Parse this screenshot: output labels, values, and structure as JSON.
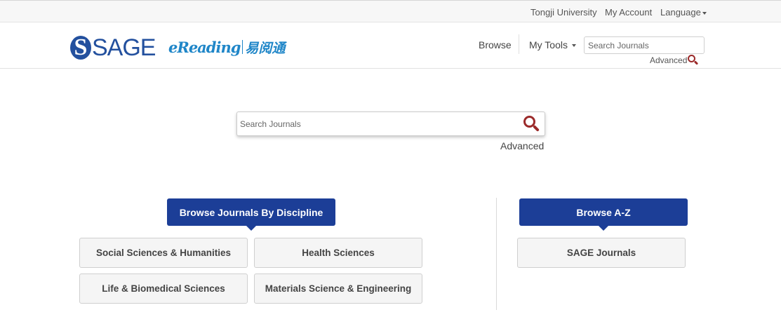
{
  "topbar": {
    "institution": "Tongji University",
    "account": "My Account",
    "language": "Language"
  },
  "header": {
    "logo_sage": "SAGE",
    "logo_sage_letter": "S",
    "logo_ereading": "eReading",
    "logo_ereading_cn": "易阅通",
    "nav_browse": "Browse",
    "nav_tools": "My Tools",
    "search_placeholder": "Search Journals",
    "advanced": "Advanced"
  },
  "main_search": {
    "placeholder": "Search Journals",
    "advanced": "Advanced"
  },
  "discipline": {
    "heading": "Browse Journals By Discipline",
    "items": [
      "Social Sciences & Humanities",
      "Health Sciences",
      "Life & Biomedical Sciences",
      "Materials Science & Engineering"
    ]
  },
  "az": {
    "heading": "Browse A-Z",
    "items": [
      "SAGE Journals"
    ]
  },
  "colors": {
    "brand_blue": "#1c3e97",
    "logo_blue": "#23509e",
    "search_icon": "#9b2a2a"
  }
}
